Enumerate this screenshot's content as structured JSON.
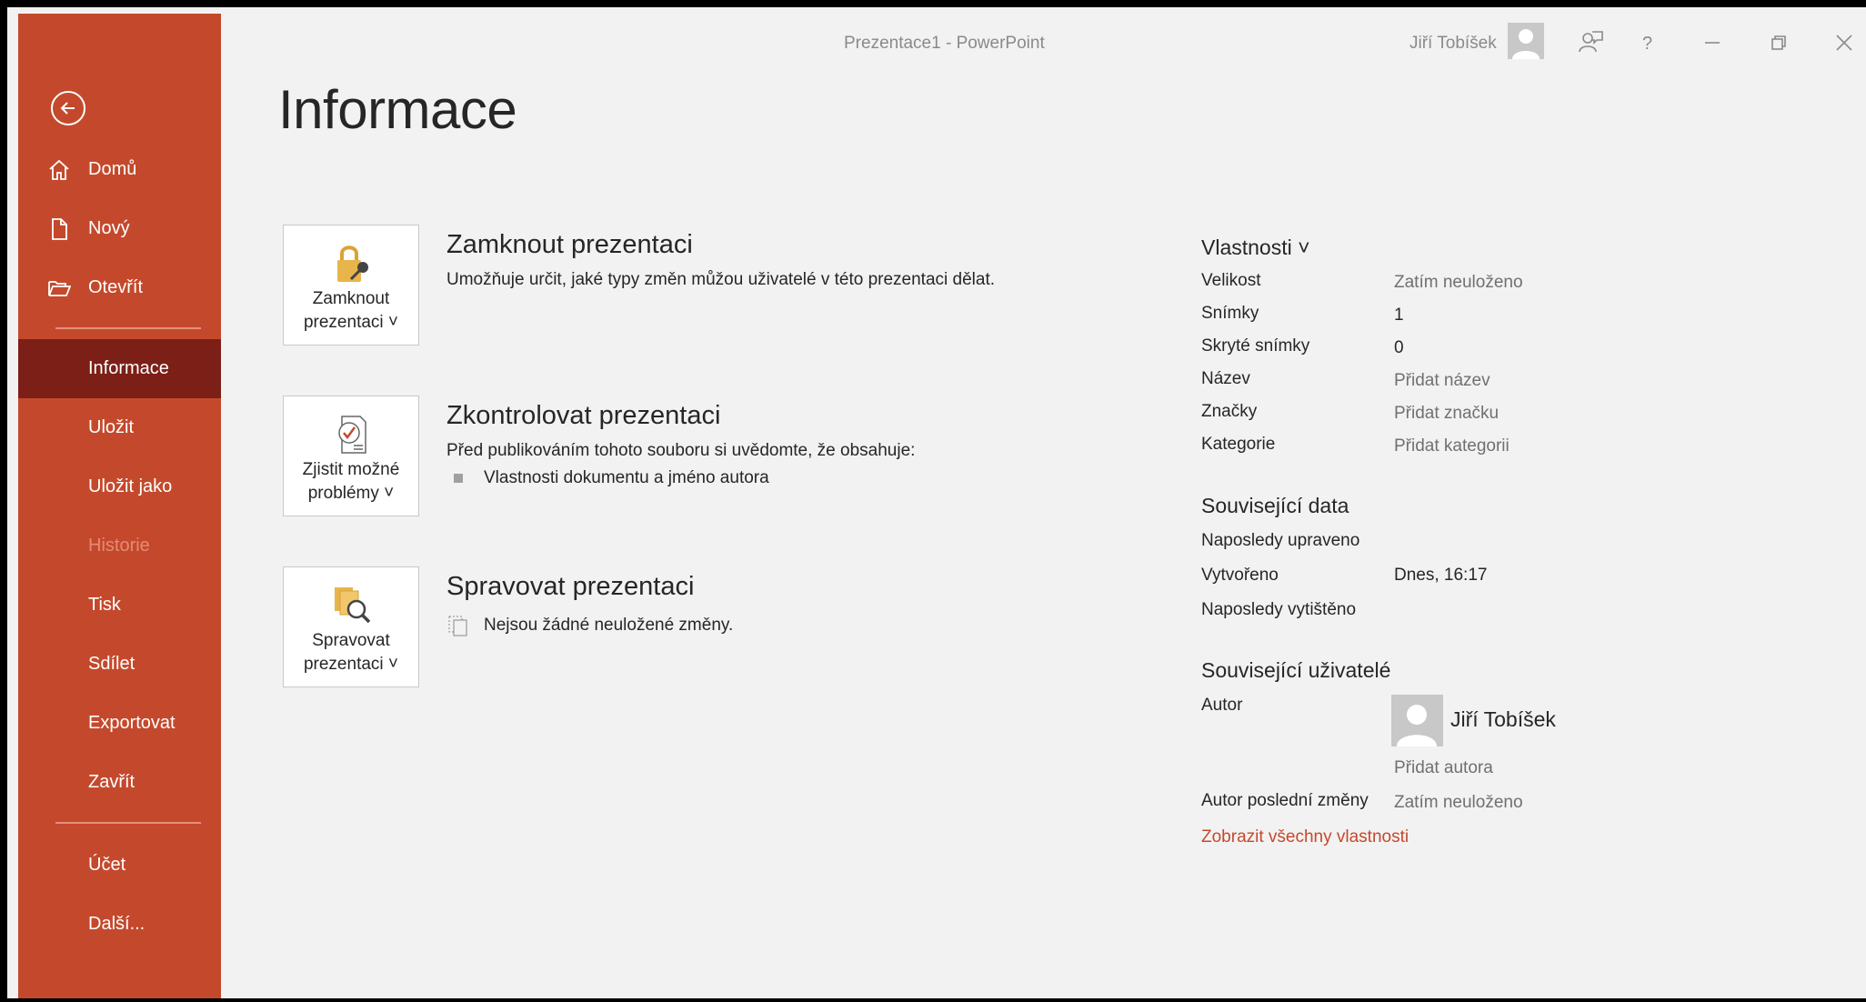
{
  "window": {
    "title": "Prezentace1  -  PowerPoint",
    "user_name": "Jiří Tobíšek"
  },
  "sidebar": {
    "items": [
      {
        "label": "Domů",
        "icon": "home-icon"
      },
      {
        "label": "Nový",
        "icon": "new-document-icon"
      },
      {
        "label": "Otevřít",
        "icon": "open-folder-icon"
      },
      {
        "label": "Informace",
        "selected": true
      },
      {
        "label": "Uložit"
      },
      {
        "label": "Uložit jako"
      },
      {
        "label": "Historie",
        "disabled": true
      },
      {
        "label": "Tisk"
      },
      {
        "label": "Sdílet"
      },
      {
        "label": "Exportovat"
      },
      {
        "label": "Zavřít"
      },
      {
        "label": "Účet"
      },
      {
        "label": "Další..."
      }
    ]
  },
  "main": {
    "title": "Informace",
    "sections": [
      {
        "button_label": "Zamknout prezentaci ˅",
        "button_icon": "lock-key-icon",
        "heading": "Zamknout prezentaci",
        "description": "Umožňuje určit, jaké typy změn můžou uživatelé v této prezentaci dělat."
      },
      {
        "button_label": "Zjistit možné problémy ˅",
        "button_icon": "inspect-checklist-icon",
        "heading": "Zkontrolovat prezentaci",
        "description": "Před publikováním tohoto souboru si uvědomte, že obsahuje:",
        "bullet": "Vlastnosti dokumentu a jméno autora"
      },
      {
        "button_label": "Spravovat prezentaci ˅",
        "button_icon": "manage-versions-icon",
        "heading": "Spravovat prezentaci",
        "description": "Nejsou žádné neuložené změny."
      }
    ]
  },
  "properties": {
    "heading": "Vlastnosti ˅",
    "rows": [
      {
        "key": "Velikost",
        "value": "Zatím neuloženo"
      },
      {
        "key": "Snímky",
        "value": "1"
      },
      {
        "key": "Skryté snímky",
        "value": "0"
      },
      {
        "key": "Název",
        "value": "Přidat název"
      },
      {
        "key": "Značky",
        "value": "Přidat značku"
      },
      {
        "key": "Kategorie",
        "value": "Přidat kategorii"
      }
    ],
    "related_data_heading": "Související data",
    "related_data": [
      {
        "key": "Naposledy upraveno",
        "value": ""
      },
      {
        "key": "Vytvořeno",
        "value": "Dnes, 16:17"
      },
      {
        "key": "Naposledy vytištěno",
        "value": ""
      }
    ],
    "related_users_heading": "Související uživatelé",
    "author_key": "Autor",
    "author_name": "Jiří Tobíšek",
    "add_author": "Přidat autora",
    "last_modified_by_key": "Autor poslední změny",
    "last_modified_by_value": "Zatím neuloženo",
    "show_all_link": "Zobrazit všechny vlastnosti"
  }
}
